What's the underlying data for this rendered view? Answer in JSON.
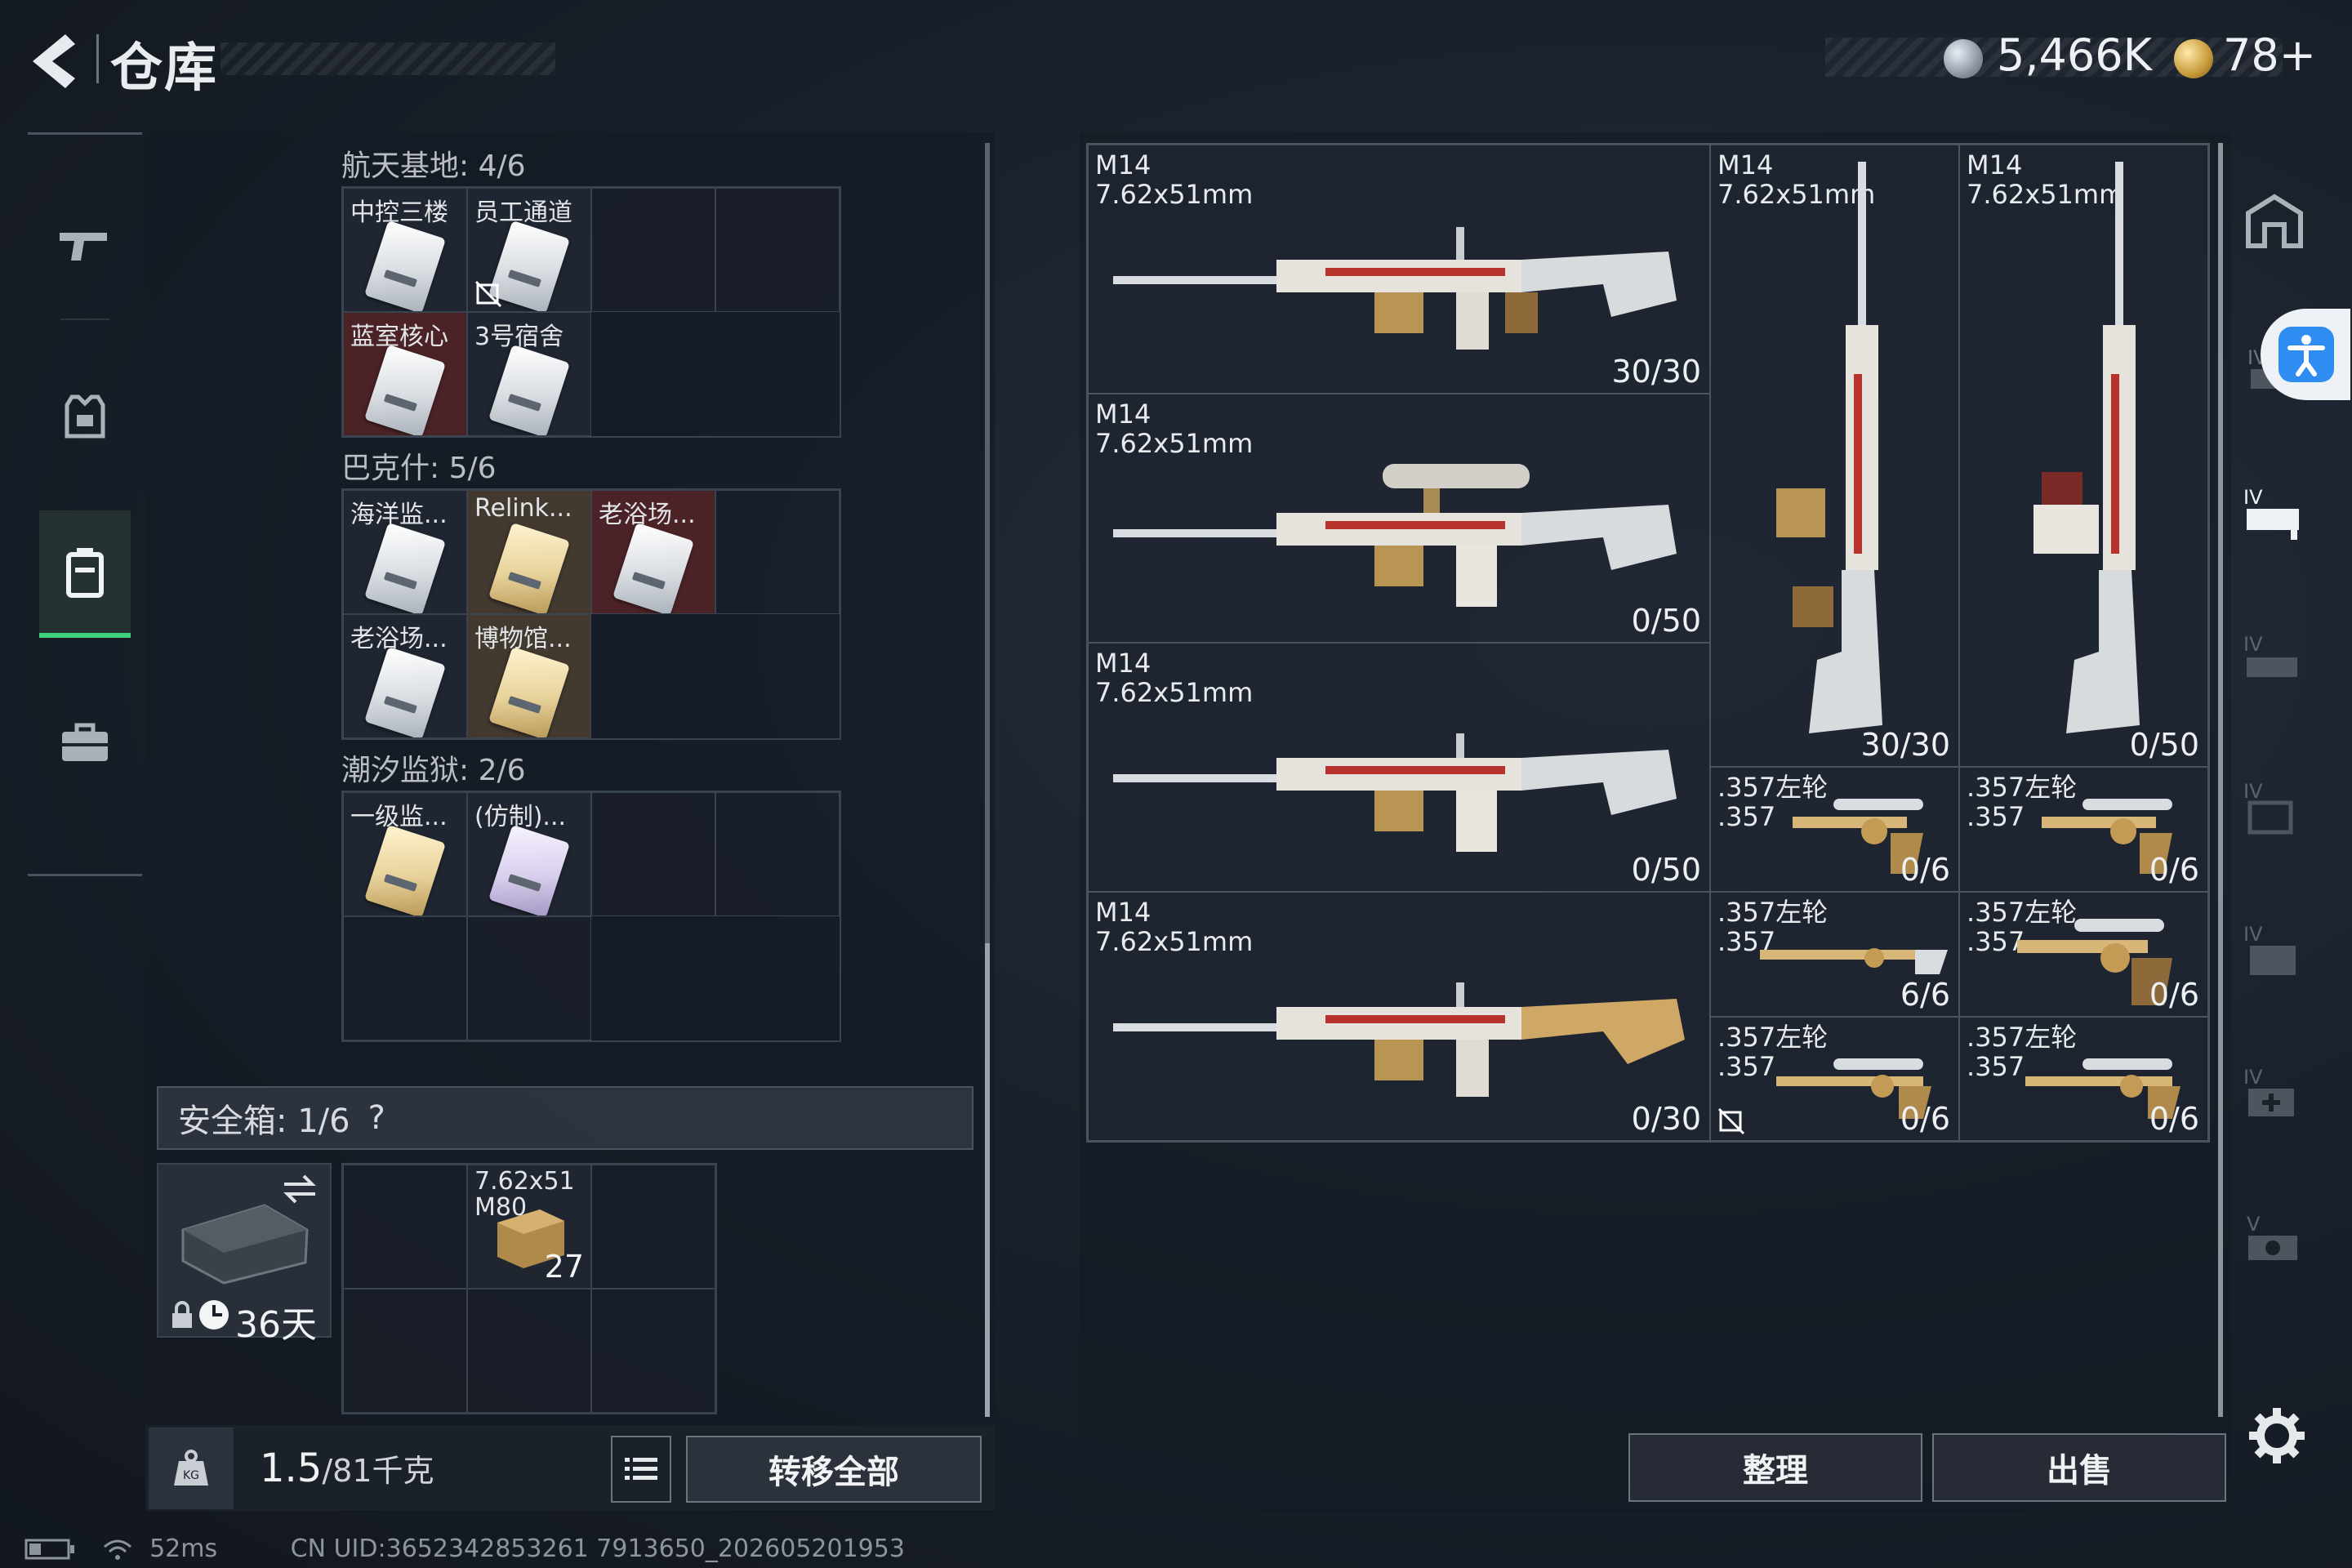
{
  "header": {
    "title": "仓库",
    "currency1": "5,466K",
    "currency2": "78+"
  },
  "sections": [
    {
      "title": "航天基地: 4/6",
      "items": [
        {
          "label": "中控三楼",
          "tint": "grey",
          "card": "white"
        },
        {
          "label": "员工通道",
          "tint": "grey",
          "card": "white",
          "no_trade": true
        },
        {
          "label": "蓝室核心",
          "tint": "red",
          "card": "white"
        },
        {
          "label": "3号宿舍",
          "tint": "grey",
          "card": "white"
        }
      ]
    },
    {
      "title": "巴克什: 5/6",
      "items": [
        {
          "label": "海洋监...",
          "tint": "grey",
          "card": "white"
        },
        {
          "label": "Relink...",
          "tint": "brown",
          "card": "gold"
        },
        {
          "label": "老浴场...",
          "tint": "red",
          "card": "white"
        },
        {
          "label": "老浴场...",
          "tint": "grey",
          "card": "white"
        },
        {
          "label": "博物馆...",
          "tint": "brown",
          "card": "gold"
        }
      ]
    },
    {
      "title": "潮汐监狱: 2/6",
      "items": [
        {
          "label": "一级监...",
          "tint": "grey",
          "card": "gold"
        },
        {
          "label": "(仿制)...",
          "tint": "grey",
          "card": "purple"
        }
      ]
    }
  ],
  "safe": {
    "title": "安全箱: 1/6",
    "help": "?",
    "duration": "36天",
    "ammo_label1": "7.62x51",
    "ammo_label2": "M80",
    "ammo_count": "27"
  },
  "weight": {
    "current": "1.5",
    "max": "/81千克"
  },
  "buttons": {
    "transfer_all": "转移全部",
    "sort": "整理",
    "sell": "出售"
  },
  "weapons": [
    {
      "name": "M14",
      "caliber": "7.62x51mm",
      "count": "30/30"
    },
    {
      "name": "M14",
      "caliber": "7.62x51mm",
      "count": "0/50"
    },
    {
      "name": "M14",
      "caliber": "7.62x51mm",
      "count": "0/50"
    },
    {
      "name": "M14",
      "caliber": "7.62x51mm",
      "count": "0/30",
      "no_trade": true
    },
    {
      "name": "M14",
      "caliber": "7.62x51mm",
      "count": "30/30"
    },
    {
      "name": "M14",
      "caliber": "7.62x51mm",
      "count": "0/50"
    },
    {
      "name": ".357左轮",
      "caliber": ".357",
      "count": "0/6"
    },
    {
      "name": ".357左轮",
      "caliber": ".357",
      "count": "0/6"
    },
    {
      "name": ".357左轮",
      "caliber": ".357",
      "count": "6/6"
    },
    {
      "name": ".357左轮",
      "caliber": ".357",
      "count": "0/6"
    },
    {
      "name": ".357左轮",
      "caliber": ".357",
      "count": "0/6",
      "no_trade": true
    },
    {
      "name": ".357左轮",
      "caliber": ".357",
      "count": "0/6"
    }
  ],
  "status": {
    "ping": "52ms",
    "uid": "CN UID:3652342853261 7913650_202605201953"
  },
  "colors": {
    "accent_green": "#3fd47c",
    "accessibility_blue": "#2f8cf0"
  }
}
